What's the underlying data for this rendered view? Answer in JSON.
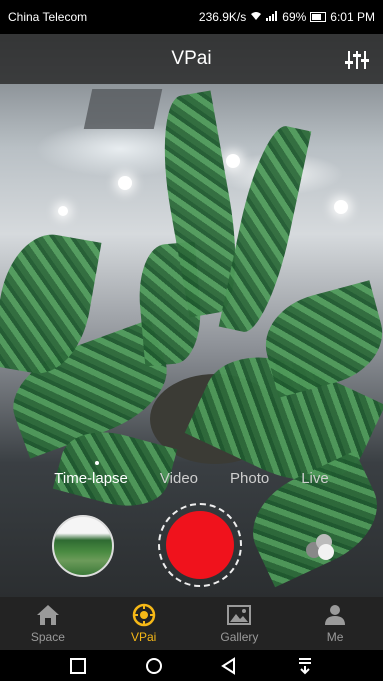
{
  "status_bar": {
    "carrier": "China Telecom",
    "speed": "236.9K/s",
    "battery": "69%",
    "time": "6:01 PM"
  },
  "header": {
    "title": "VPai"
  },
  "modes": [
    {
      "label": "Time-lapse",
      "active": true
    },
    {
      "label": "Video",
      "active": false
    },
    {
      "label": "Photo",
      "active": false
    },
    {
      "label": "Live",
      "active": false
    }
  ],
  "nav": [
    {
      "label": "Space",
      "icon": "home-icon"
    },
    {
      "label": "VPai",
      "icon": "camera-icon",
      "active": true
    },
    {
      "label": "Gallery",
      "icon": "image-icon"
    },
    {
      "label": "Me",
      "icon": "person-icon"
    }
  ],
  "colors": {
    "accent": "#f6b817",
    "shutter": "#f0121c"
  }
}
